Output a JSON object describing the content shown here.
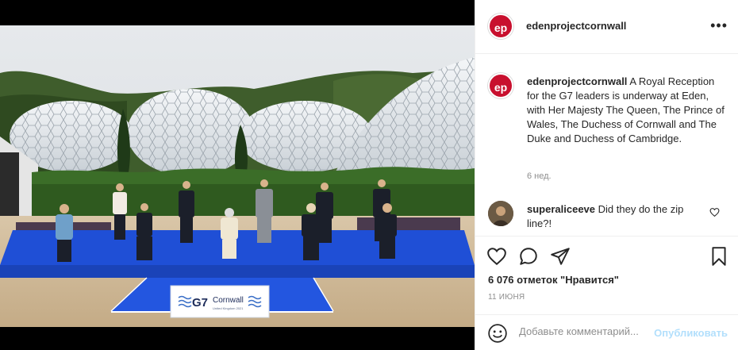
{
  "post": {
    "account": "edenprojectcornwall",
    "avatar_text": "ep",
    "caption": "A Royal Reception for the G7 leaders is underway at Eden, with Her Majesty The Queen, The Prince of Wales, The Duchess of Cornwall and The Duke and Duchess of Cambridge.",
    "time_ago": "6 нед.",
    "likes": "6 076 отметок \"Нравится\"",
    "date": "11 ИЮНЯ"
  },
  "photo": {
    "sign_logo": "G7",
    "sign_title": "Cornwall",
    "sign_subtitle": "United Kingdom 2021"
  },
  "comments": [
    {
      "user": "superaliceeve",
      "text": "Did they do the zip line?!"
    }
  ],
  "add_comment": {
    "placeholder": "Добавьте комментарий...",
    "post_label": "Опубликовать"
  },
  "icons": {
    "more": "more-options-icon",
    "like": "heart-icon",
    "comment": "comment-icon",
    "share": "share-icon",
    "save": "bookmark-icon",
    "emoji": "emoji-icon"
  },
  "colors": {
    "brand_red": "#c8102e",
    "stage_blue": "#1f4fd6",
    "post_button": "#b2dffc"
  }
}
